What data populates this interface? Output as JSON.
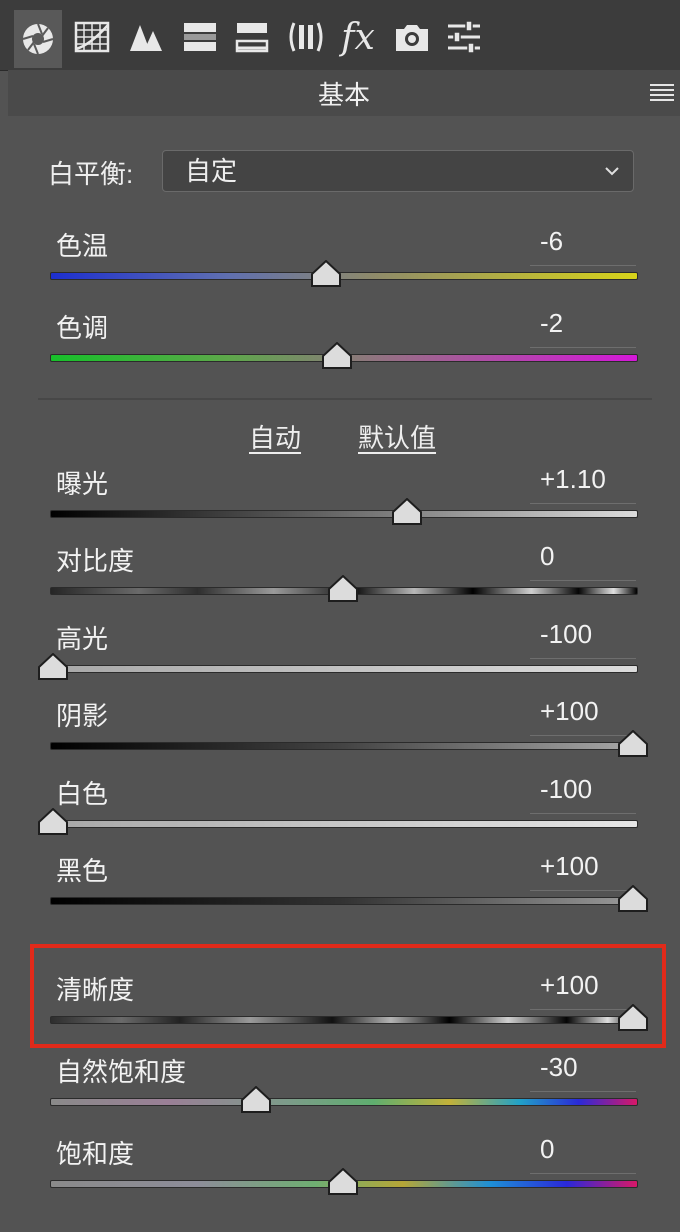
{
  "toolbar": {
    "tools": [
      {
        "name": "basic-aperture-icon"
      },
      {
        "name": "tone-curve-grid-icon"
      },
      {
        "name": "detail-triangles-icon"
      },
      {
        "name": "hsl-gradient-icon"
      },
      {
        "name": "split-toning-icon"
      },
      {
        "name": "lens-corrections-icon"
      },
      {
        "name": "effects-fx-icon"
      },
      {
        "name": "camera-calibration-icon"
      },
      {
        "name": "presets-sliders-icon"
      }
    ],
    "fx_label": "fx"
  },
  "panel": {
    "title": "基本"
  },
  "white_balance": {
    "label": "白平衡:",
    "value": "自定"
  },
  "auto_label": "自动",
  "default_label": "默认值",
  "sliders": [
    {
      "key": "temp",
      "label": "色温",
      "value": "-6",
      "level": 0.47
    },
    {
      "key": "tint",
      "label": "色调",
      "value": "-2",
      "level": 0.49
    },
    {
      "key": "exposure",
      "label": "曝光",
      "value": "+1.10",
      "level": 0.61
    },
    {
      "key": "contrast",
      "label": "对比度",
      "value": "0",
      "level": 0.5
    },
    {
      "key": "highlights",
      "label": "高光",
      "value": "-100",
      "level": 0.0
    },
    {
      "key": "shadows",
      "label": "阴影",
      "value": "+100",
      "level": 1.0
    },
    {
      "key": "whites",
      "label": "白色",
      "value": "-100",
      "level": 0.0
    },
    {
      "key": "blacks",
      "label": "黑色",
      "value": "+100",
      "level": 1.0
    },
    {
      "key": "clarity",
      "label": "清晰度",
      "value": "+100",
      "level": 1.0
    },
    {
      "key": "vibrance",
      "label": "自然饱和度",
      "value": "-30",
      "level": 0.35
    },
    {
      "key": "saturation",
      "label": "饱和度",
      "value": "0",
      "level": 0.5
    }
  ],
  "colors": {
    "highlight_box": "#e12a1a",
    "background": "#535353"
  }
}
